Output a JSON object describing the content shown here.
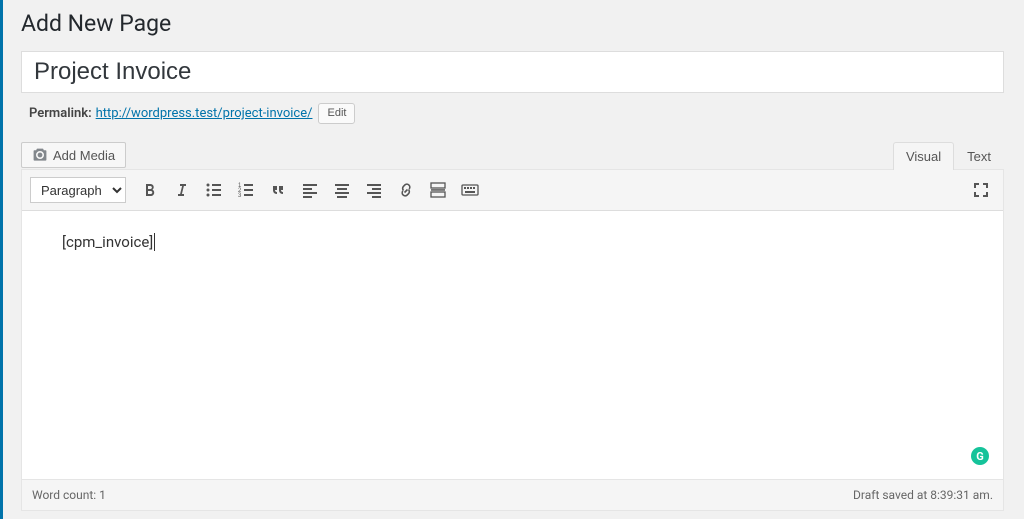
{
  "header": {
    "title": "Add New Page"
  },
  "post": {
    "title_value": "Project Invoice"
  },
  "permalink": {
    "label": "Permalink:",
    "url_text": "http://wordpress.test/project-invoice/",
    "edit_label": "Edit"
  },
  "media": {
    "add_media_label": "Add Media"
  },
  "editor_tabs": {
    "visual": "Visual",
    "text": "Text"
  },
  "toolbar": {
    "format_value": "Paragraph"
  },
  "editor": {
    "content": "[cpm_invoice]"
  },
  "grammarly": {
    "glyph": "G"
  },
  "footer": {
    "word_count_label": "Word count: 1",
    "draft_saved_label": "Draft saved at 8:39:31 am."
  }
}
